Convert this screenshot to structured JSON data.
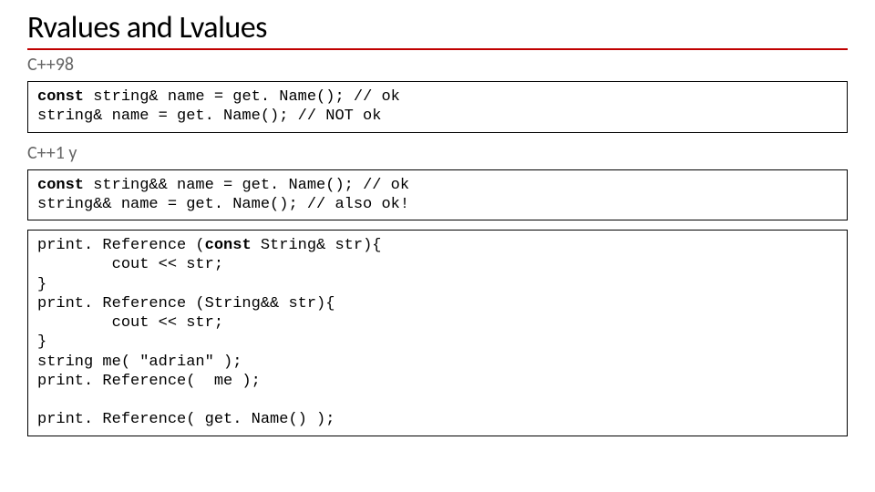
{
  "title": "Rvalues and Lvalues",
  "section1": {
    "heading": "C++98"
  },
  "section2": {
    "heading": "C++1 y"
  },
  "code1": {
    "l1a": "const",
    "l1b": " string& name = get. Name(); // ok",
    "l2": "string& name = get. Name(); // NOT ok"
  },
  "code2": {
    "l1a": "const",
    "l1b": " string&& name = get. Name(); // ok",
    "l2": "string&& name = get. Name(); // also ok!"
  },
  "code3": {
    "l1a": "print. Reference (",
    "l1b": "const",
    "l1c": " String& str){",
    "l2": "        cout << str;",
    "l3": "}",
    "l4": "print. Reference (String&& str){",
    "l5": "        cout << str;",
    "l6": "}",
    "l7": "string me( \"adrian\" );",
    "l8": "print. Reference(  me );",
    "l9": "",
    "l10": "print. Reference( get. Name() );"
  }
}
